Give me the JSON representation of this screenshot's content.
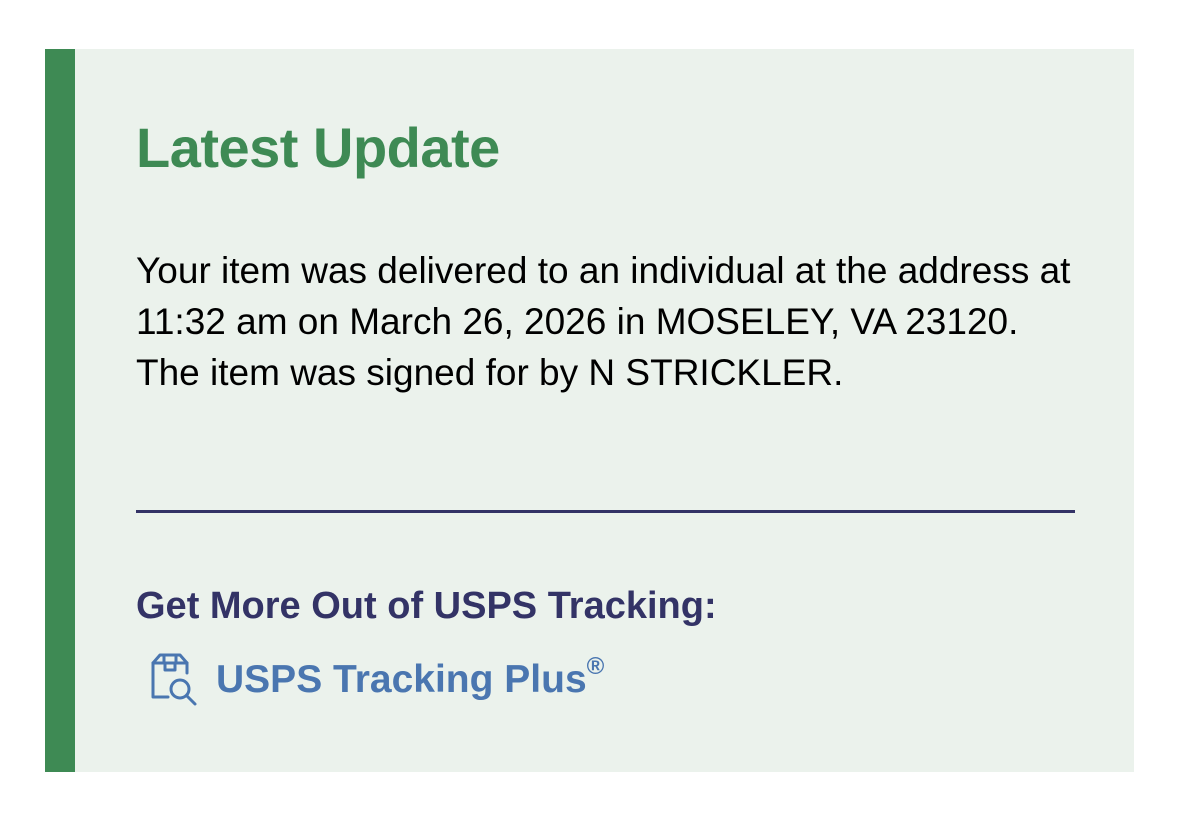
{
  "card": {
    "title": "Latest Update",
    "message": "Your item was delivered to an individual at the address at 11:32 am on March 26, 2026 in MOSELEY, VA 23120. The item was signed for by N STRICKLER.",
    "promo_heading": "Get More Out of USPS Tracking:",
    "promo_link_label": "USPS Tracking Plus",
    "promo_link_mark": "®",
    "promo_link_icon": "package-search-icon"
  },
  "colors": {
    "accent_green": "#3e8a54",
    "card_background": "#ebf2ec",
    "navy": "#333366",
    "link_blue": "#4a76b0"
  }
}
